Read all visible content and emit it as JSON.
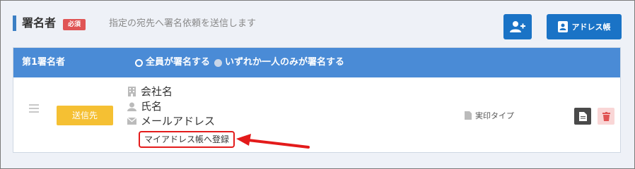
{
  "section": {
    "title": "署名者",
    "required_badge": "必須",
    "description": "指定の宛先へ署名依頼を送信します",
    "address_book_button": "アドレス帳"
  },
  "signer": {
    "header_label": "第1署名者",
    "radio_options": [
      {
        "label": "全員が署名する",
        "selected": true
      },
      {
        "label": "いずれか一人のみが署名する",
        "selected": false
      }
    ],
    "send_button": "送信先",
    "company_field": "会社名",
    "name_field": "氏名",
    "email_field": "メールアドレス",
    "register_link": "マイアドレス帳へ登録",
    "seal_type": "実印タイプ"
  },
  "icons": {
    "add_user": "add-user-icon",
    "address_book": "address-book-icon",
    "building": "building-icon",
    "person": "person-icon",
    "envelope": "envelope-icon",
    "document": "document-icon",
    "trash": "trash-icon",
    "drag": "drag-handle-icon"
  },
  "colors": {
    "accent": "#3b7fc4",
    "primary_button": "#1a73c6",
    "header_bar": "#4a8bd6",
    "required_badge": "#e05454",
    "send_button": "#f5c033",
    "highlight": "#e31b1b"
  }
}
